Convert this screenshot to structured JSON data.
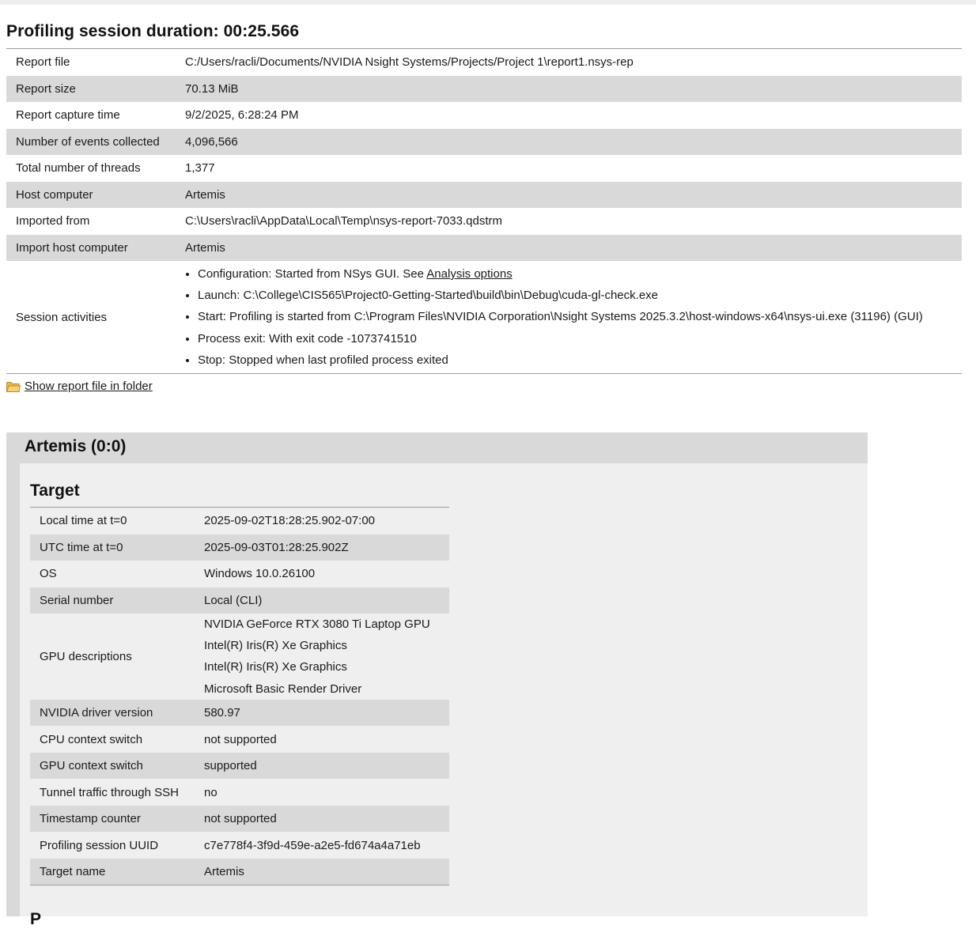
{
  "session": {
    "title": "Profiling session duration: 00:25.566",
    "rows": [
      {
        "label": "Report file",
        "value": "C:/Users/racli/Documents/NVIDIA Nsight Systems/Projects/Project 1\\report1.nsys-rep"
      },
      {
        "label": "Report size",
        "value": "70.13 MiB"
      },
      {
        "label": "Report capture time",
        "value": "9/2/2025, 6:28:24 PM"
      },
      {
        "label": "Number of events collected",
        "value": "4,096,566"
      },
      {
        "label": "Total number of threads",
        "value": "1,377"
      },
      {
        "label": "Host computer",
        "value": "Artemis"
      },
      {
        "label": "Imported from",
        "value": "C:\\Users\\racli\\AppData\\Local\\Temp\\nsys-report-7033.qdstrm"
      },
      {
        "label": "Import host computer",
        "value": "Artemis"
      }
    ],
    "activities_label": "Session activities",
    "activities": {
      "configuration_prefix": "Configuration: Started from NSys GUI. See ",
      "analysis_options_link": "Analysis options",
      "launch": "Launch: C:\\College\\CIS565\\Project0-Getting-Started\\build\\bin\\Debug\\cuda-gl-check.exe",
      "start": "Start: Profiling is started from C:\\Program Files\\NVIDIA Corporation\\Nsight Systems 2025.3.2\\host-windows-x64\\nsys-ui.exe (31196) (GUI)",
      "process_exit": "Process exit: With exit code -1073741510",
      "stop": "Stop: Stopped when last profiled process exited"
    }
  },
  "folder_link": {
    "label": "Show report file in folder",
    "icon": "folder-icon"
  },
  "host_panel": {
    "title": "Artemis (0:0)",
    "target": {
      "title": "Target",
      "rows_before": [
        {
          "label": "Local time at t=0",
          "value": "2025-09-02T18:28:25.902-07:00"
        },
        {
          "label": "UTC time at t=0",
          "value": "2025-09-03T01:28:25.902Z"
        },
        {
          "label": "OS",
          "value": "Windows 10.0.26100"
        },
        {
          "label": "Serial number",
          "value": "Local (CLI)"
        }
      ],
      "gpu_label": "GPU descriptions",
      "gpus": [
        "NVIDIA GeForce RTX 3080 Ti Laptop GPU",
        "Intel(R) Iris(R) Xe Graphics",
        "Intel(R) Iris(R) Xe Graphics",
        "Microsoft Basic Render Driver"
      ],
      "rows_after": [
        {
          "label": "NVIDIA driver version",
          "value": "580.97"
        },
        {
          "label": "CPU context switch",
          "value": "not supported"
        },
        {
          "label": "GPU context switch",
          "value": "supported"
        },
        {
          "label": "Tunnel traffic through SSH",
          "value": "no"
        },
        {
          "label": "Timestamp counter",
          "value": "not supported"
        },
        {
          "label": "Profiling session UUID",
          "value": "c7e778f4-3f9d-459e-a2e5-fd674a4a71eb"
        },
        {
          "label": "Target name",
          "value": "Artemis"
        }
      ]
    },
    "next_section_partial": "P"
  }
}
